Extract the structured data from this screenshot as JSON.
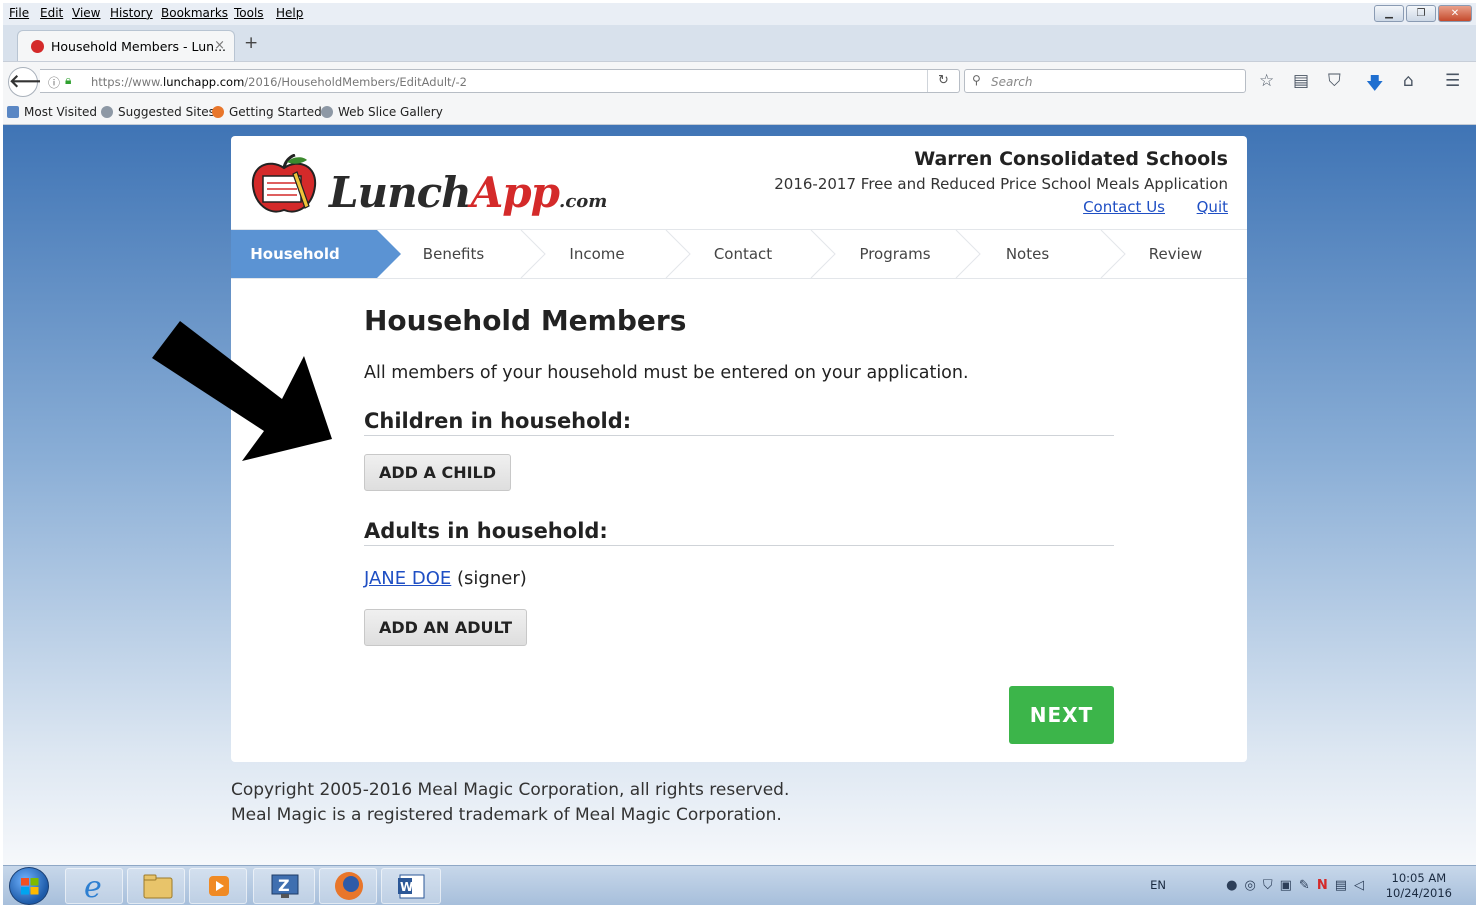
{
  "browser": {
    "menu": [
      "File",
      "Edit",
      "View",
      "History",
      "Bookmarks",
      "Tools",
      "Help"
    ],
    "tab_title": "Household Members - Lun...",
    "tab_close": "×",
    "new_tab": "+",
    "url_prefix": "https://www.",
    "url_domain": "lunchapp.com",
    "url_path": "/2016/HouseholdMembers/EditAdult/-2",
    "search_placeholder": "Search",
    "bookmarks": [
      "Most Visited",
      "Suggested Sites",
      "Getting Started",
      "Web Slice Gallery"
    ],
    "toolbar_icons": [
      "star-icon",
      "reading-list-icon",
      "pocket-icon",
      "download-icon",
      "home-icon",
      "menu-icon"
    ]
  },
  "page": {
    "logo_text": "Lunch",
    "logo_text_app": "App",
    "logo_suffix": ".com",
    "school_name": "Warren Consolidated Schools",
    "subtitle": "2016-2017 Free and Reduced Price School Meals Application",
    "contact_link": "Contact Us",
    "quit_link": "Quit",
    "steps": [
      "Household",
      "Benefits",
      "Income",
      "Contact",
      "Programs",
      "Notes",
      "Review"
    ],
    "active_step": "Household",
    "title": "Household Members",
    "intro": "All members of your household must be entered on your application.",
    "children_heading": "Children in household:",
    "add_child": "ADD A CHILD",
    "adults_heading": "Adults in household:",
    "adult_name": "JANE DOE",
    "adult_role": "(signer)",
    "add_adult": "ADD AN ADULT",
    "next": "NEXT",
    "footer_line1": "Copyright 2005-2016 Meal Magic Corporation, all rights reserved.",
    "footer_line2": "Meal Magic is a registered trademark of Meal Magic Corporation."
  },
  "colors": {
    "active_step": "#5b93d3",
    "next_button": "#3cb54a",
    "link": "#1f4fc4",
    "brand_red": "#d42a2a"
  },
  "taskbar": {
    "language": "EN",
    "time": "10:05 AM",
    "date": "10/24/2016"
  }
}
